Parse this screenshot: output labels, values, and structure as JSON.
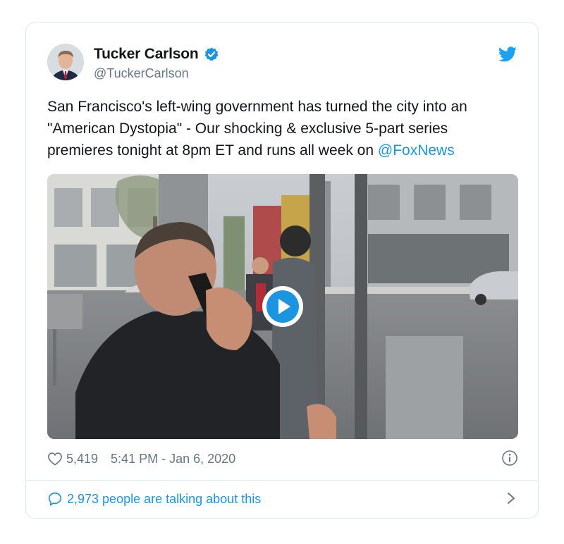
{
  "tweet": {
    "author": {
      "display_name": "Tucker Carlson",
      "handle": "@TuckerCarlson",
      "verified": true
    },
    "text": {
      "line1": "San Francisco's left-wing government has turned the city into an",
      "line2": "\"American Dystopia\" - Our shocking & exclusive 5-part series",
      "line3_prefix": "premieres tonight at 8pm ET and runs all week on ",
      "mention": "@FoxNews"
    },
    "media": {
      "type": "video",
      "play_icon": "play-icon"
    },
    "likes": "5,419",
    "timestamp": "5:41 PM - Jan 6, 2020",
    "talking": "2,973 people are talking about this"
  },
  "colors": {
    "accent": "#1b95e0",
    "text": "#14171a",
    "muted": "#657786",
    "border": "#e1e8ed"
  },
  "icons": [
    "verified-badge-icon",
    "twitter-bird-icon",
    "heart-icon",
    "info-icon",
    "speech-bubble-icon",
    "chevron-right-icon"
  ]
}
